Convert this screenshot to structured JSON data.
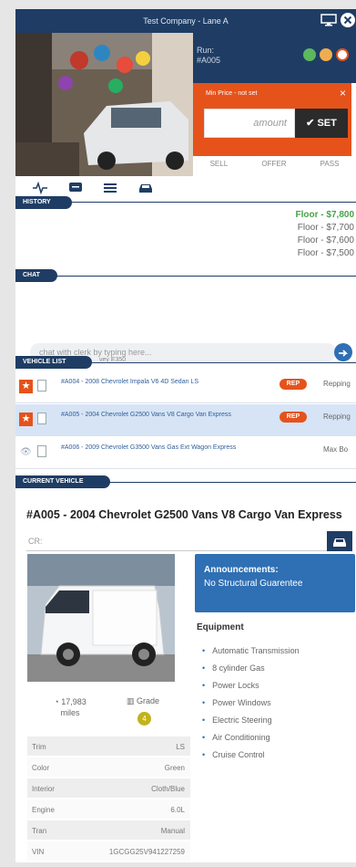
{
  "topbar": {
    "title": "Test Company - Lane A"
  },
  "run": {
    "label": "Run:",
    "number": "#A005"
  },
  "status_colors": [
    "#5cb85c",
    "#f0ad4e",
    "#ffffff"
  ],
  "min_price": {
    "label": "Min Price - not set",
    "amount_placeholder": "amount",
    "set_label": "SET"
  },
  "actions": [
    "SELL",
    "OFFER",
    "PASS"
  ],
  "history": {
    "header": "HISTORY",
    "entries": [
      "Floor - $7,800",
      "Floor - $7,700",
      "Floor - $7,600",
      "Floor - $7,500"
    ]
  },
  "chat": {
    "header": "CHAT",
    "placeholder": "chat with clerk by typing here..."
  },
  "vehicle_list": {
    "header": "VEHICLE LIST",
    "peek_text": "vey E350",
    "rows": [
      {
        "desc": "#A004 - 2008 Chevrolet Impala V6 4D Sedan LS",
        "badge": "REP",
        "who": "Repping"
      },
      {
        "desc": "#A005 - 2004 Chevrolet G2500 Vans V8 Cargo Van Express",
        "badge": "REP",
        "who": "Repping"
      },
      {
        "desc": "#A006 - 2009 Chevrolet G3500 Vans Gas Ext Wagon Express",
        "badge": "",
        "who": "Max Bo"
      }
    ]
  },
  "current_vehicle": {
    "header": "CURRENT VEHICLE",
    "title": "#A005 - 2004 Chevrolet G2500 Vans V8 Cargo Van Express",
    "cr_placeholder": "CR:",
    "announcement_title": "Announcements:",
    "announcement_text": "No Structural Guarentee",
    "equipment_title": "Equipment",
    "equipment": [
      "Automatic Transmission",
      "8 cylinder Gas",
      "Power Locks",
      "Power Windows",
      "Electric Steering",
      "Air Conditioning",
      "Cruise Control"
    ],
    "miles_value": "17,983",
    "miles_label": "miles",
    "grade_label": "Grade",
    "grade_value": "4",
    "specs": [
      {
        "k": "Trim",
        "v": "LS"
      },
      {
        "k": "Color",
        "v": "Green"
      },
      {
        "k": "Interior",
        "v": "Cloth/Blue"
      },
      {
        "k": "Engine",
        "v": "6.0L"
      },
      {
        "k": "Tran",
        "v": "Manual"
      },
      {
        "k": "VIN",
        "v": "1GCGG25V941227259"
      }
    ]
  }
}
